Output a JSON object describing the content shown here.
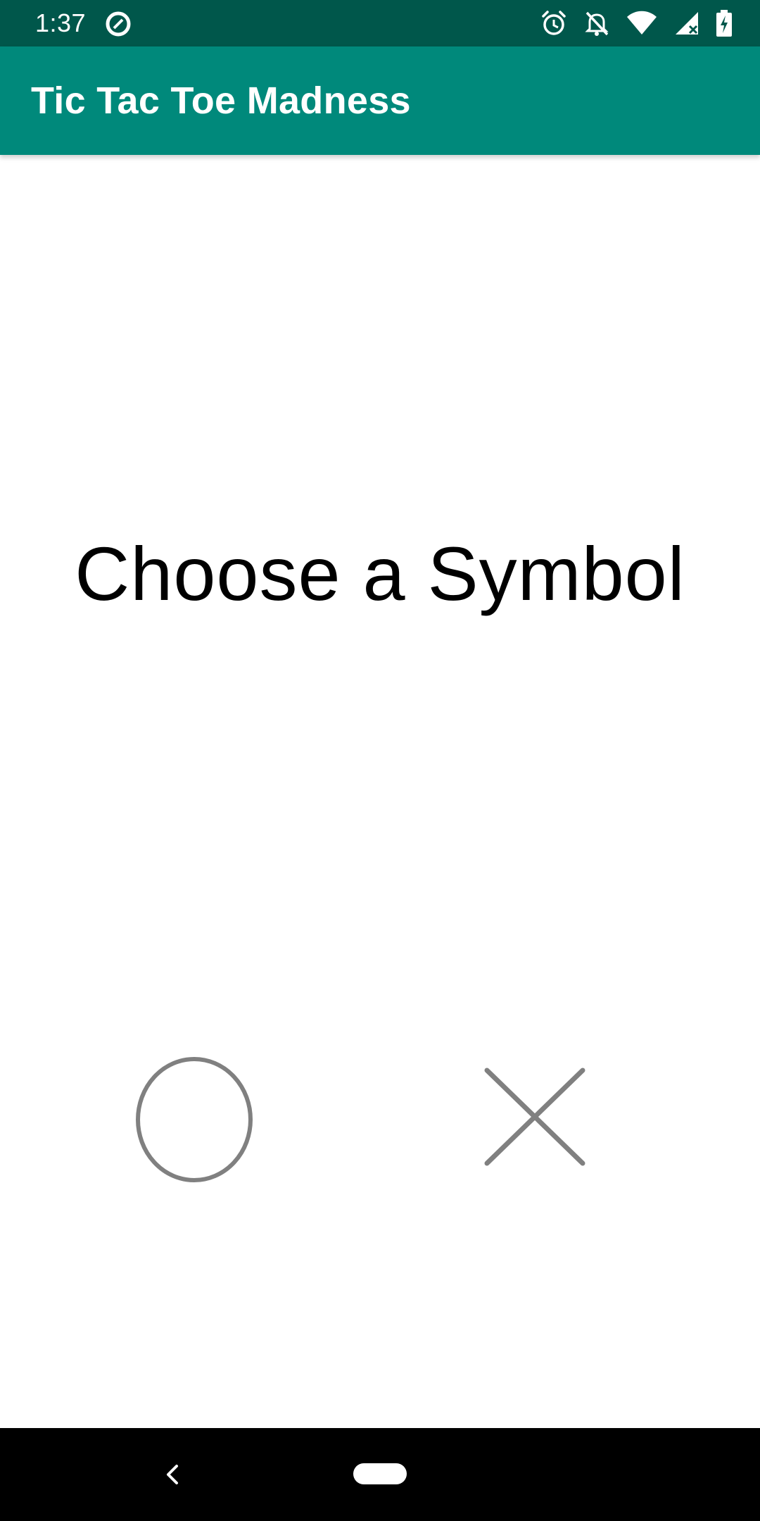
{
  "status_bar": {
    "time": "1:37",
    "background_color": "#00574b",
    "icons": [
      "data-saver-icon",
      "alarm-icon",
      "notifications-off-icon",
      "wifi-icon",
      "cellular-signal-icon",
      "battery-charging-icon"
    ]
  },
  "app_bar": {
    "title": "Tic Tac Toe Madness",
    "background_color": "#00897b"
  },
  "main": {
    "prompt": "Choose a Symbol",
    "symbols": [
      {
        "name": "O",
        "icon": "circle-o-icon"
      },
      {
        "name": "X",
        "icon": "cross-x-icon"
      }
    ],
    "symbol_color": "#808080"
  },
  "nav_bar": {
    "icons": [
      "back-icon",
      "home-pill-icon"
    ]
  }
}
